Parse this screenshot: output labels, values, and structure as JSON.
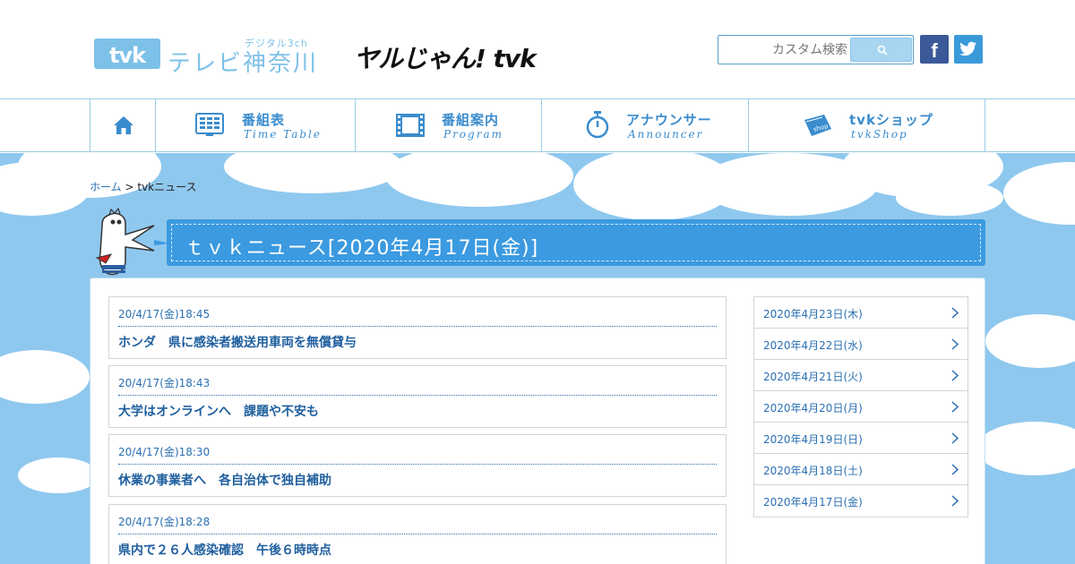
{
  "header": {
    "logo_mark": "tvk",
    "logo_sub": "デジタル3ch",
    "logo_name": "テレビ神奈川",
    "slogan": "ヤルじゃん! tvk",
    "search_placeholder": "カスタム検索",
    "facebook_label": "f"
  },
  "nav": {
    "home": "home",
    "items": [
      {
        "jp": "番組表",
        "en": "Time Table"
      },
      {
        "jp": "番組案内",
        "en": "Program"
      },
      {
        "jp": "アナウンサー",
        "en": "Announcer"
      },
      {
        "jp": "tvkショップ",
        "en": "tvkShop"
      }
    ]
  },
  "breadcrumb": {
    "home": "ホーム",
    "separator": ">",
    "current": "tvkニュース"
  },
  "page_title": "ｔｖｋニュース[2020年4月17日(金)]",
  "news": [
    {
      "time": "20/4/17(金)18:45",
      "title": "ホンダ　県に感染者搬送用車両を無償貸与"
    },
    {
      "time": "20/4/17(金)18:43",
      "title": "大学はオンラインへ　課題や不安も"
    },
    {
      "time": "20/4/17(金)18:30",
      "title": "休業の事業者へ　各自治体で独自補助"
    },
    {
      "time": "20/4/17(金)18:28",
      "title": "県内で２６人感染確認　午後６時時点"
    }
  ],
  "dates": [
    "2020年4月23日(木)",
    "2020年4月22日(水)",
    "2020年4月21日(火)",
    "2020年4月20日(月)",
    "2020年4月19日(日)",
    "2020年4月18日(土)",
    "2020年4月17日(金)"
  ],
  "colors": {
    "accent": "#3b9ae0",
    "link": "#2a6fb2",
    "sky": "#8fc8ee",
    "facebook": "#3b5998",
    "twitter": "#3a9ad9"
  }
}
